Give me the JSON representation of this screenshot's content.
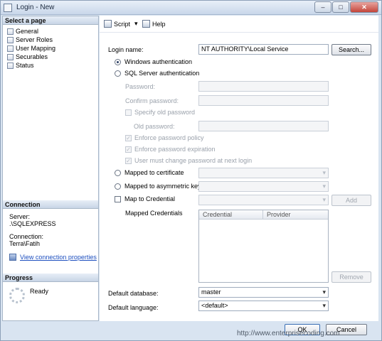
{
  "window": {
    "title": "Login - New",
    "minimize": "–",
    "maximize": "□",
    "close": "✕"
  },
  "left": {
    "select_page_header": "Select a page",
    "pages": [
      "General",
      "Server Roles",
      "User Mapping",
      "Securables",
      "Status"
    ],
    "connection_header": "Connection",
    "server_label": "Server:",
    "server_value": ".\\SQLEXPRESS",
    "connection_label": "Connection:",
    "connection_value": "Terra\\Fatih",
    "view_props_link": "View connection properties",
    "progress_header": "Progress",
    "progress_status": "Ready"
  },
  "toolbar": {
    "script_label": "Script",
    "script_dropdown": "▾",
    "help_label": "Help"
  },
  "form": {
    "login_name_label": "Login name:",
    "login_name_value": "NT AUTHORITY\\Local Service",
    "search_button": "Search...",
    "windows_auth": "Windows authentication",
    "sql_auth": "SQL Server authentication",
    "password_label": "Password:",
    "confirm_password_label": "Confirm password:",
    "specify_old_password": "Specify old password",
    "old_password_label": "Old password:",
    "enforce_policy": "Enforce password policy",
    "enforce_expiration": "Enforce password expiration",
    "must_change": "User must change password at next login",
    "mapped_certificate": "Mapped to certificate",
    "mapped_asym_key": "Mapped to asymmetric key",
    "map_credential": "Map to Credential",
    "add_button": "Add",
    "mapped_credentials_label": "Mapped Credentials",
    "grid_columns": [
      "Credential",
      "Provider"
    ],
    "remove_button": "Remove",
    "default_db_label": "Default database:",
    "default_db_value": "master",
    "default_lang_label": "Default language:",
    "default_lang_value": "<default>",
    "checkmark": "✓"
  },
  "buttons": {
    "ok": "OK",
    "cancel": "Cancel"
  },
  "watermark": "http://www.enterprisecoding.com"
}
